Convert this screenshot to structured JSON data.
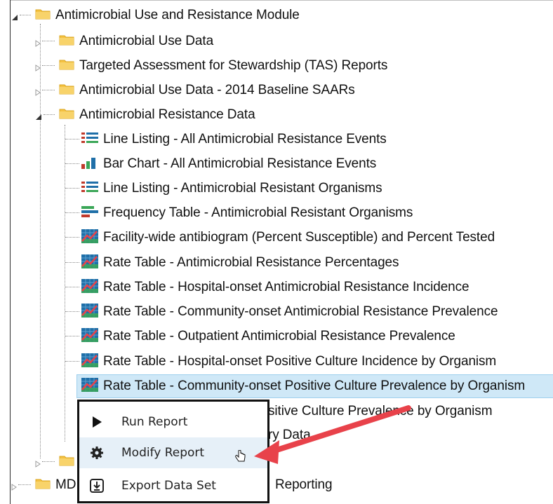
{
  "tree": {
    "root": {
      "label": "Antimicrobial Use and Resistance Module"
    },
    "folders": [
      {
        "label": "Antimicrobial Use Data"
      },
      {
        "label": "Targeted Assessment for Stewardship (TAS) Reports"
      },
      {
        "label": "Antimicrobial Use Data - 2014 Baseline SAARs"
      },
      {
        "label": "Antimicrobial Resistance Data"
      }
    ],
    "reports": [
      {
        "label": "Line Listing - All Antimicrobial Resistance Events",
        "icon": "line-listing-icon"
      },
      {
        "label": "Bar Chart - All Antimicrobial Resistance Events",
        "icon": "bar-chart-icon"
      },
      {
        "label": "Line Listing - Antimicrobial Resistant Organisms",
        "icon": "line-listing-icon"
      },
      {
        "label": "Frequency Table - Antimicrobial Resistant Organisms",
        "icon": "frequency-table-icon"
      },
      {
        "label": "Facility-wide antibiogram (Percent Susceptible) and Percent Tested",
        "icon": "rate-table-icon"
      },
      {
        "label": "Rate Table - Antimicrobial Resistance Percentages",
        "icon": "rate-table-icon"
      },
      {
        "label": "Rate Table - Hospital-onset Antimicrobial Resistance Incidence",
        "icon": "rate-table-icon"
      },
      {
        "label": "Rate Table - Community-onset Antimicrobial Resistance Prevalence",
        "icon": "rate-table-icon"
      },
      {
        "label": "Rate Table - Outpatient Antimicrobial Resistance Prevalence",
        "icon": "rate-table-icon"
      },
      {
        "label": "Rate Table - Hospital-onset Positive Culture Incidence by Organism",
        "icon": "rate-table-icon"
      },
      {
        "label": "Rate Table - Community-onset Positive Culture Prevalence by Organism",
        "icon": "rate-table-icon"
      },
      {
        "label": "sitive Culture Prevalence by Organism",
        "icon": "rate-table-icon"
      },
      {
        "label": "ry Data",
        "icon": "rate-table-icon"
      }
    ],
    "partial_rows": [
      {
        "label": "MD"
      },
      {
        "label": "Reporting"
      }
    ]
  },
  "context_menu": {
    "items": [
      {
        "label": "Run Report",
        "icon": "play-icon"
      },
      {
        "label": "Modify Report",
        "icon": "gear-icon"
      },
      {
        "label": "Export Data Set",
        "icon": "export-icon"
      }
    ]
  },
  "colors": {
    "selection_bg": "#cfe8f7",
    "arrow": "#e8424a",
    "folder": "#f5c242"
  }
}
